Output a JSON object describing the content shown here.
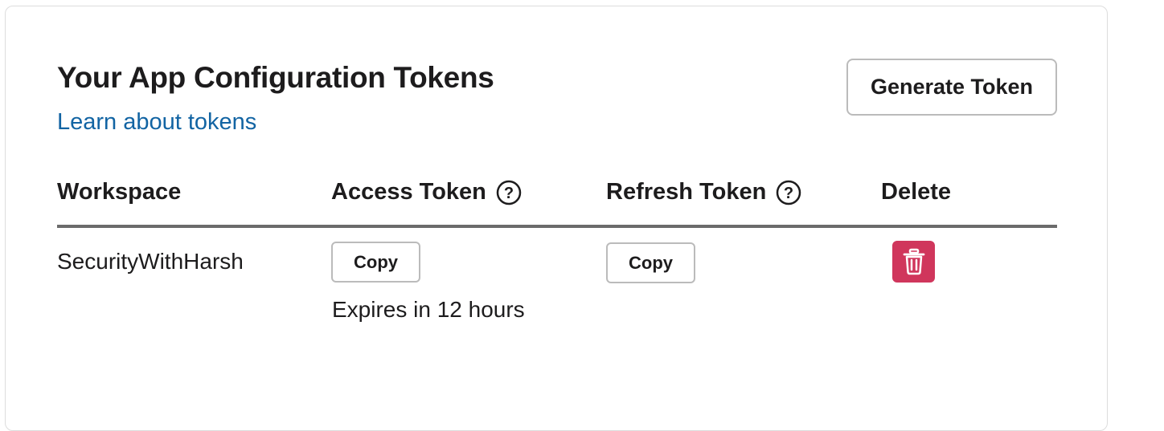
{
  "panel": {
    "title": "Your App Configuration Tokens",
    "learn_link": "Learn about tokens",
    "generate_button": "Generate Token"
  },
  "table": {
    "columns": [
      {
        "label": "Workspace",
        "has_help_icon": false
      },
      {
        "label": "Access Token",
        "has_help_icon": true
      },
      {
        "label": "Refresh Token",
        "has_help_icon": true
      },
      {
        "label": "Delete",
        "has_help_icon": false
      }
    ],
    "rows": [
      {
        "workspace": "SecurityWithHarsh",
        "access_copy_label": "Copy",
        "access_expiry": "Expires in 12 hours",
        "refresh_copy_label": "Copy",
        "delete_icon": "trash-icon"
      }
    ]
  },
  "colors": {
    "link": "#1264a3",
    "delete_bg": "#d0365c",
    "header_rule": "#6b6b6b",
    "button_border": "#bbbbbb"
  }
}
